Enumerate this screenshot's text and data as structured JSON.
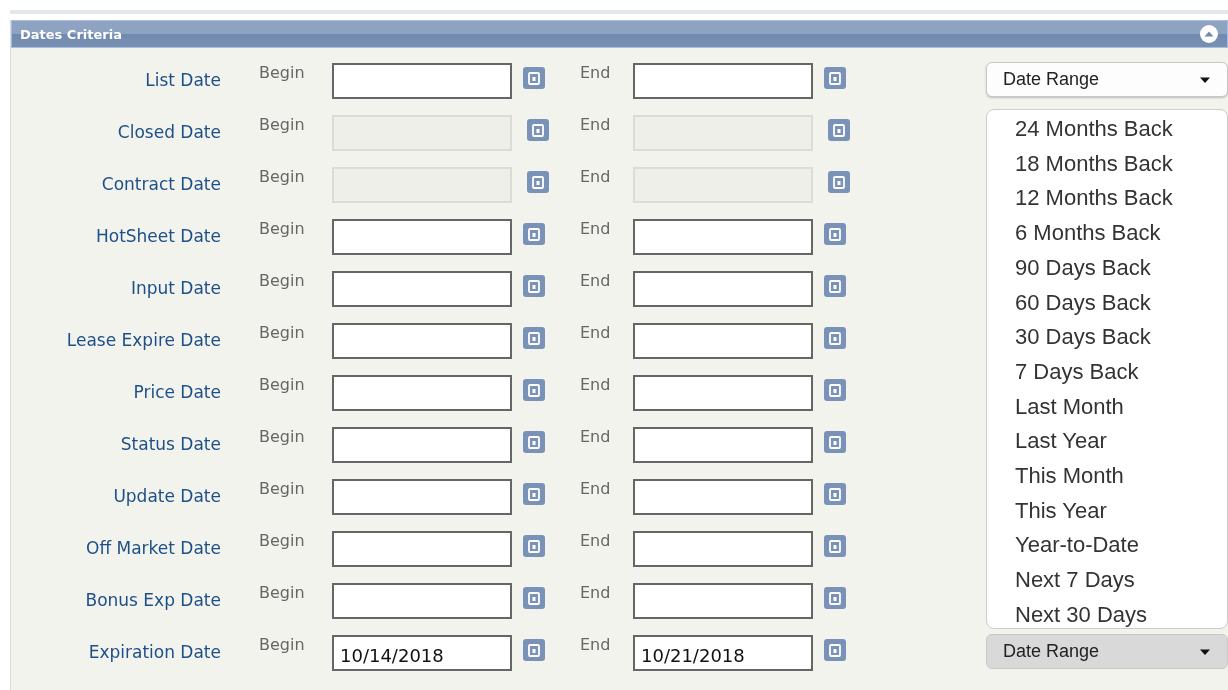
{
  "panel": {
    "title": "Dates Criteria"
  },
  "rows": [
    {
      "label": "List Date",
      "begin_label": "Begin",
      "begin": "",
      "end_label": "End",
      "end": "",
      "disabled": false
    },
    {
      "label": "Closed Date",
      "begin_label": "Begin",
      "begin": "",
      "end_label": "End",
      "end": "",
      "disabled": true
    },
    {
      "label": "Contract Date",
      "begin_label": "Begin",
      "begin": "",
      "end_label": "End",
      "end": "",
      "disabled": true
    },
    {
      "label": "HotSheet Date",
      "begin_label": "Begin",
      "begin": "",
      "end_label": "End",
      "end": "",
      "disabled": false
    },
    {
      "label": "Input Date",
      "begin_label": "Begin",
      "begin": "",
      "end_label": "End",
      "end": "",
      "disabled": false
    },
    {
      "label": "Lease Expire Date",
      "begin_label": "Begin",
      "begin": "",
      "end_label": "End",
      "end": "",
      "disabled": false
    },
    {
      "label": "Price Date",
      "begin_label": "Begin",
      "begin": "",
      "end_label": "End",
      "end": "",
      "disabled": false
    },
    {
      "label": "Status Date",
      "begin_label": "Begin",
      "begin": "",
      "end_label": "End",
      "end": "",
      "disabled": false
    },
    {
      "label": "Update Date",
      "begin_label": "Begin",
      "begin": "",
      "end_label": "End",
      "end": "",
      "disabled": false
    },
    {
      "label": "Off Market Date",
      "begin_label": "Begin",
      "begin": "",
      "end_label": "End",
      "end": "",
      "disabled": false
    },
    {
      "label": "Bonus Exp Date",
      "begin_label": "Begin",
      "begin": "",
      "end_label": "End",
      "end": "",
      "disabled": false
    },
    {
      "label": "Expiration Date",
      "begin_label": "Begin",
      "begin": "10/14/2018",
      "end_label": "End",
      "end": "10/21/2018",
      "disabled": false
    }
  ],
  "date_range_controls": [
    {
      "label": "Date Range",
      "expanded": true,
      "options": [
        "24 Months Back",
        "18 Months Back",
        "12 Months Back",
        "6 Months Back",
        "90 Days Back",
        "60 Days Back",
        "30 Days Back",
        "7 Days Back",
        "Last Month",
        "Last Year",
        "This Month",
        "This Year",
        "Year-to-Date",
        "Next 7 Days",
        "Next 30 Days"
      ]
    },
    {
      "label": "Date Range",
      "expanded": false
    }
  ]
}
